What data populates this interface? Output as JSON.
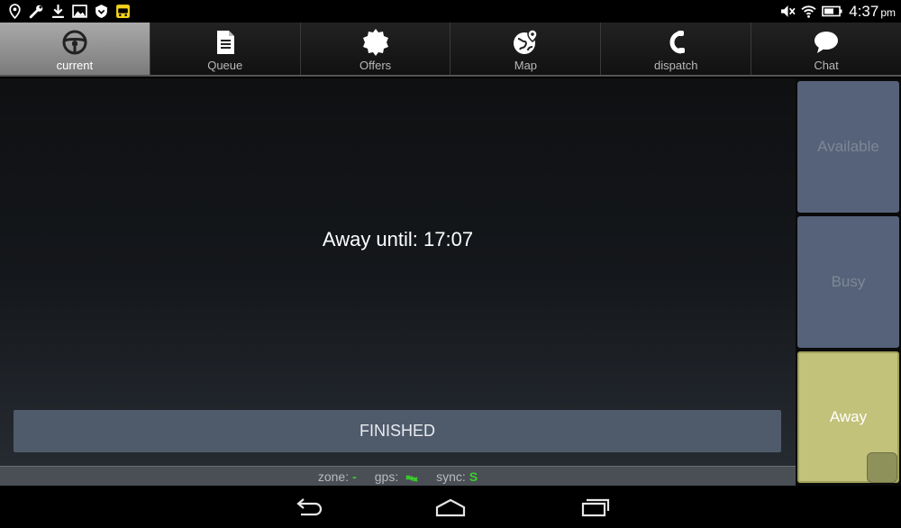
{
  "status_bar": {
    "left_icons": [
      "location-pin-icon",
      "wrench-icon",
      "download-icon",
      "image-icon",
      "shield-icon",
      "taxi-icon"
    ],
    "right_icons": [
      "mute-icon",
      "wifi-icon",
      "battery-icon"
    ],
    "time": "4:37",
    "ampm": "pm"
  },
  "tabs": [
    {
      "label": "current",
      "icon": "steering-wheel-icon",
      "active": true
    },
    {
      "label": "Queue",
      "icon": "document-icon",
      "active": false
    },
    {
      "label": "Offers",
      "icon": "badge-icon",
      "active": false
    },
    {
      "label": "Map",
      "icon": "globe-pin-icon",
      "active": false
    },
    {
      "label": "dispatch",
      "icon": "headset-icon",
      "active": false
    },
    {
      "label": "Chat",
      "icon": "chat-bubble-icon",
      "active": false
    }
  ],
  "main": {
    "status_message": "Away until: 17:07",
    "finished_label": "FINISHED"
  },
  "side_buttons": {
    "available": "Available",
    "busy": "Busy",
    "away": "Away"
  },
  "strip": {
    "zone_label": "zone:",
    "zone_value": "-",
    "gps_label": "gps:",
    "sync_label": "sync:",
    "sync_value": "S"
  },
  "colors": {
    "active_tab": "#9a9a9a",
    "button_slate": "#566279",
    "away_selected": "#c2c27a",
    "ok_green": "#3ad12a"
  }
}
